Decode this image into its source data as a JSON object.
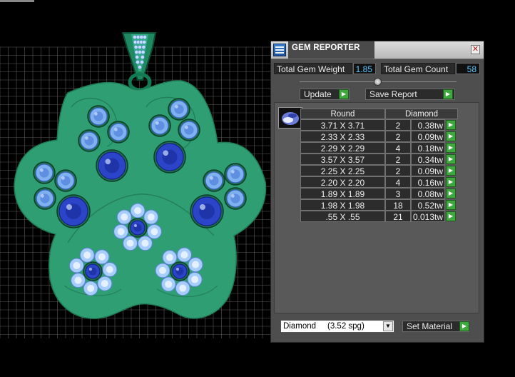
{
  "colors": {
    "background": "#000000",
    "grid": "#5a5a5a",
    "pendant_metal": "#2f9f73",
    "pendant_shadow": "#207a55",
    "gem_dark_blue": "#2c45c8",
    "gem_light_blue": "#7fb0f0",
    "panel_bg": "#4e4e4e",
    "value_text": "#5ec8ff",
    "action_green": "#3ea83e"
  },
  "panel": {
    "title": "GEM REPORTER",
    "icon": "gem-reporter-app-icon",
    "close_icon": "close-icon"
  },
  "stats": {
    "total_weight_label": "Total Gem Weight",
    "total_weight_value": "1.85",
    "total_count_label": "Total Gem Count",
    "total_count_value": "58"
  },
  "toolbar": {
    "update_label": "Update",
    "save_report_label": "Save Report"
  },
  "table": {
    "shape_header": "Round",
    "material_header": "Diamond",
    "thumbnail_icon": "round-gem-icon",
    "rows": [
      {
        "size": "3.71 X 3.71",
        "count": "2",
        "weight": "0.38tw"
      },
      {
        "size": "2.33 X 2.33",
        "count": "2",
        "weight": "0.09tw"
      },
      {
        "size": "2.29 X 2.29",
        "count": "4",
        "weight": "0.18tw"
      },
      {
        "size": "3.57 X 3.57",
        "count": "2",
        "weight": "0.34tw"
      },
      {
        "size": "2.25 X 2.25",
        "count": "2",
        "weight": "0.09tw"
      },
      {
        "size": "2.20 X 2.20",
        "count": "4",
        "weight": "0.16tw"
      },
      {
        "size": "1.89 X 1.89",
        "count": "3",
        "weight": "0.08tw"
      },
      {
        "size": "1.98 X 1.98",
        "count": "18",
        "weight": "0.52tw"
      },
      {
        "size": ".55 X .55",
        "count": "21",
        "weight": "0.013tw"
      }
    ]
  },
  "material": {
    "selected": "Diamond     (3.52 spg)",
    "set_material_label": "Set Material"
  }
}
